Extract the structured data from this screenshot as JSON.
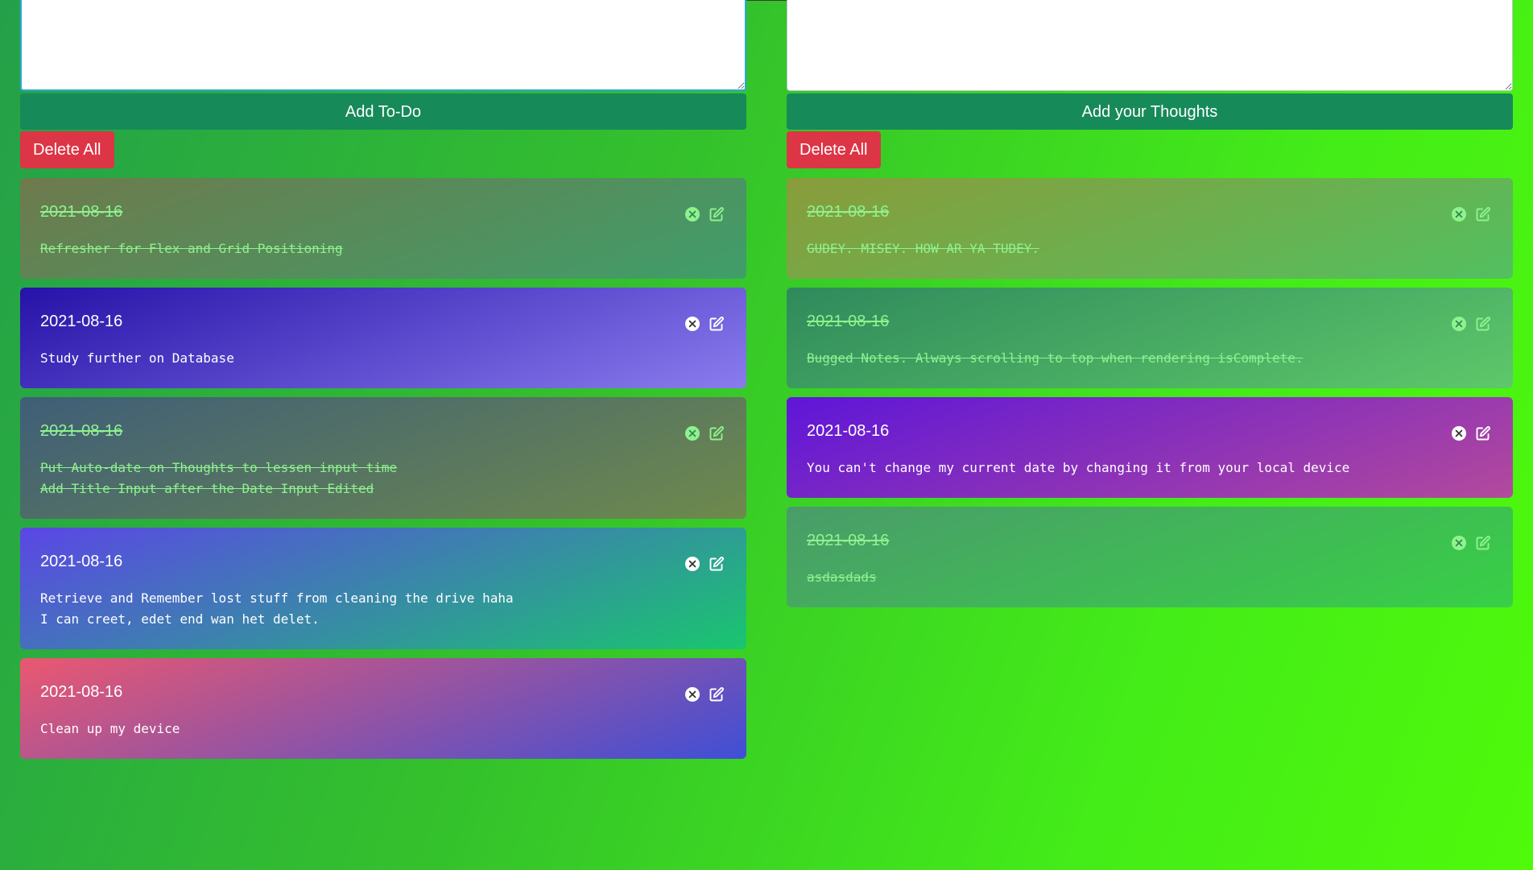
{
  "todo": {
    "input": {
      "value": "",
      "placeholder": ""
    },
    "add_label": "Add To-Do",
    "delete_all_label": "Delete All",
    "items": [
      {
        "date": "2021-08-16",
        "text": "Refresher for Flex and Grid Positioning",
        "complete": true,
        "gradient": [
          "#6e7a4c",
          "#3f9e6a"
        ]
      },
      {
        "date": "2021-08-16",
        "text": "Study further on Database",
        "complete": false,
        "gradient": [
          "#2612a8",
          "#8a7cee"
        ]
      },
      {
        "date": "2021-08-16",
        "text": "Put Auto-date on Thoughts to lessen input time\nAdd Title Input after the Date Input Edited",
        "complete": true,
        "gradient": [
          "#3f5e78",
          "#6e8a4c"
        ]
      },
      {
        "date": "2021-08-16",
        "text": "Retrieve and Remember lost stuff from cleaning the drive haha\nI can creet, edet end wan het delet.",
        "complete": false,
        "gradient": [
          "#5b46e6",
          "#19c66e"
        ]
      },
      {
        "date": "2021-08-16",
        "text": "Clean up my device",
        "complete": false,
        "gradient": [
          "#ea5870",
          "#3f4fd6"
        ]
      }
    ]
  },
  "thoughts": {
    "input": {
      "value": "",
      "placeholder": ""
    },
    "add_label": "Add your Thoughts",
    "delete_all_label": "Delete All",
    "items": [
      {
        "date": "2021-08-16",
        "text": "GUDEY. MISEY. HOW AR YA TUDEY.",
        "complete": true,
        "gradient": [
          "#8a9c3a",
          "#52c060"
        ]
      },
      {
        "date": "2021-08-16",
        "text": "Bugged Notes. Always scrolling to top when rendering isComplete.",
        "complete": true,
        "gradient": [
          "#2f8a5c",
          "#5ec86a"
        ]
      },
      {
        "date": "2021-08-16",
        "text": "You can't change my current date by changing it from your local device",
        "complete": false,
        "gradient": [
          "#5e16d8",
          "#b34a9c"
        ]
      },
      {
        "date": "2021-08-16",
        "text": "asdasdads",
        "complete": true,
        "gradient": [
          "#4a9c6a",
          "#38d046"
        ]
      }
    ]
  },
  "colors": {
    "add_button": "#178a59",
    "delete_button": "#dc3545",
    "strike_text": "#8ff28f"
  },
  "icons": {
    "remove": "close-circle-icon",
    "edit": "edit-square-icon"
  }
}
